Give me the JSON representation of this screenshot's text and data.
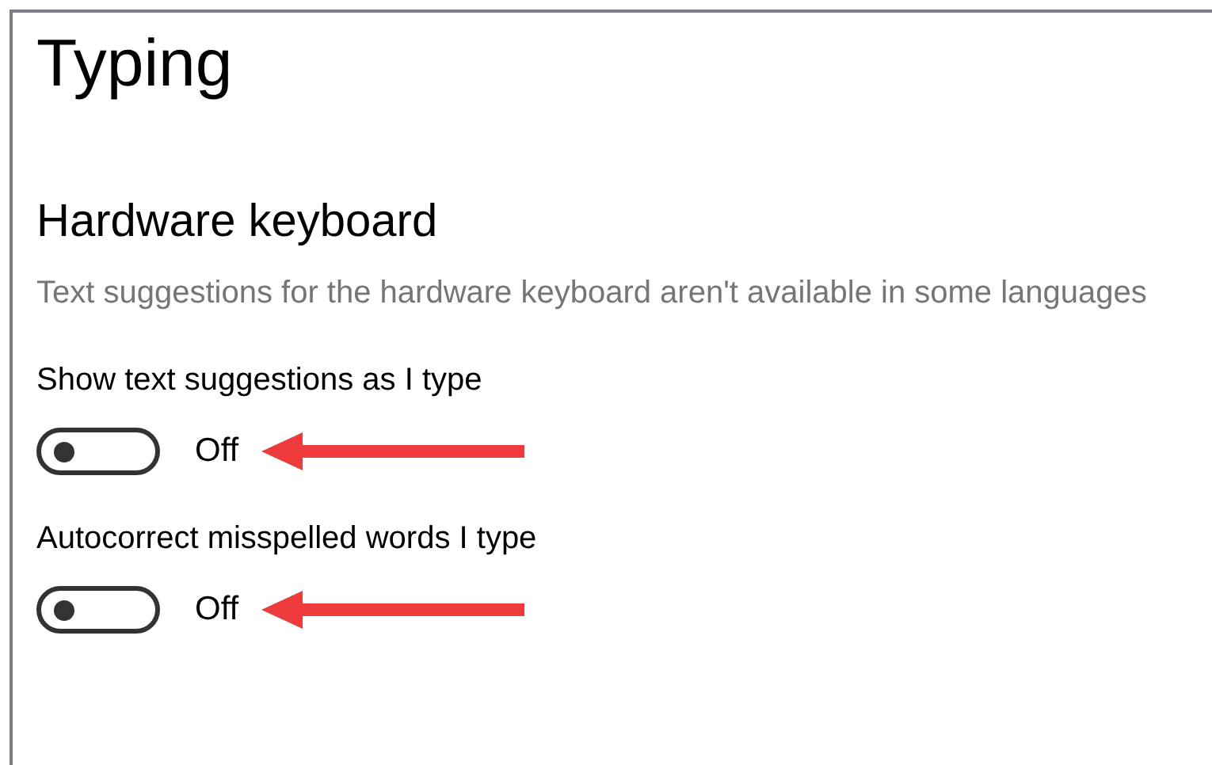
{
  "page": {
    "title": "Typing"
  },
  "section": {
    "heading": "Hardware keyboard",
    "description": "Text suggestions for the hardware keyboard aren't available in some languages"
  },
  "settings": [
    {
      "label": "Show text suggestions as I type",
      "on": false,
      "state_text": "Off"
    },
    {
      "label": "Autocorrect misspelled words I type",
      "on": false,
      "state_text": "Off"
    }
  ]
}
